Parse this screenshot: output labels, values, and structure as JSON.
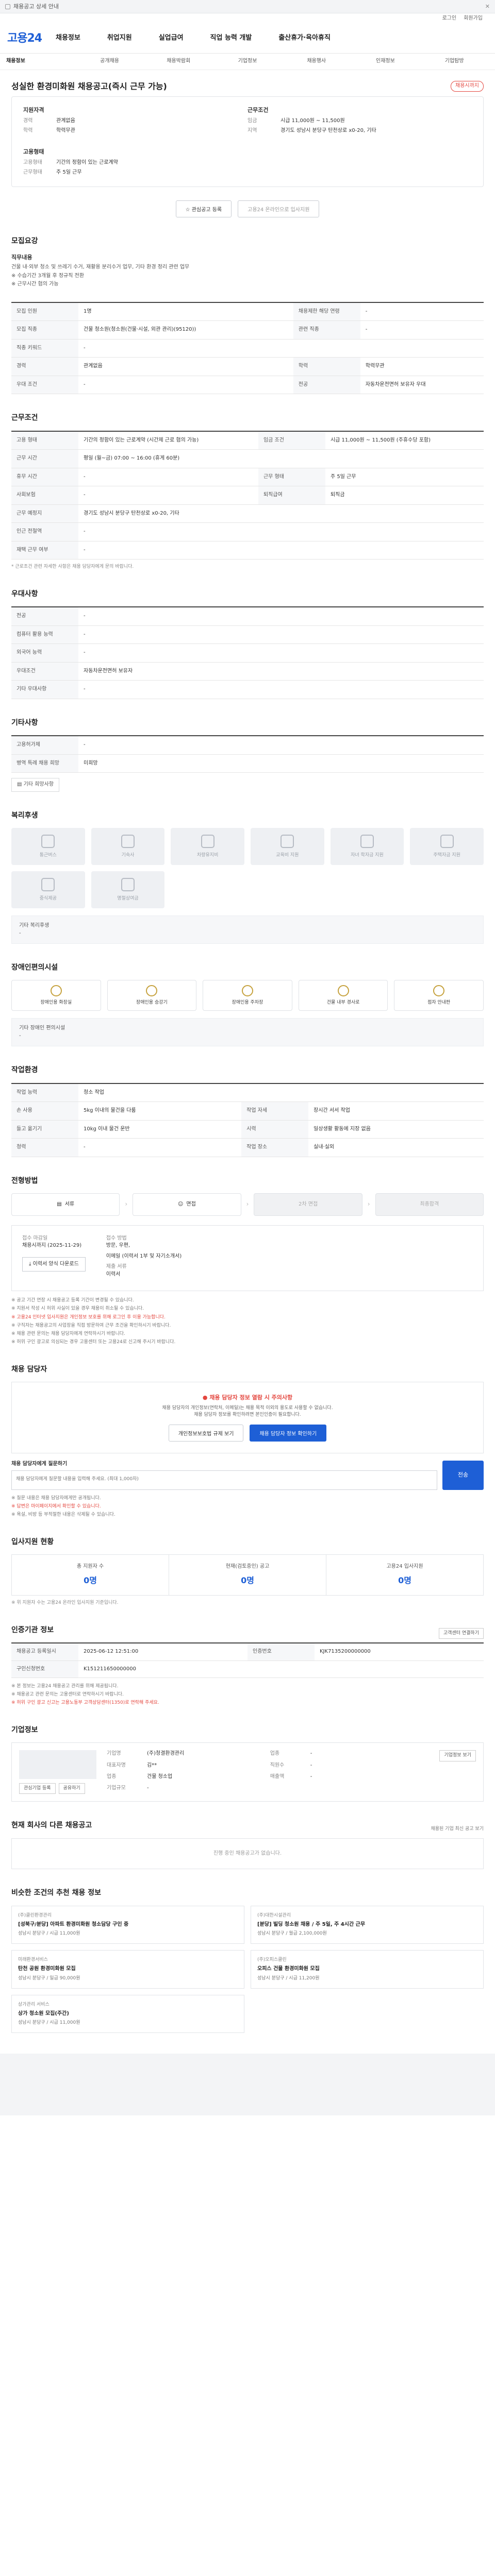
{
  "topbar": {
    "text": "채용공고 상세 안내 "
  },
  "util": [
    "로그인",
    "회원가입"
  ],
  "header": {
    "logo": "고용24",
    "gnb": [
      "채용정보",
      "취업지원",
      "실업급여",
      "직업 능력 개발",
      "출산휴가·육아휴직"
    ]
  },
  "subnav": [
    "채용정보",
    "공개채용",
    "채용박람회",
    "기업정보",
    "채용행사",
    "인재정보",
    "기업탐방"
  ],
  "title": {
    "text": "성실한 환경미화원 채용공고(즉시 근무 가능)",
    "tag": "채용시까지"
  },
  "summary": {
    "left_head": "지원자격",
    "left": [
      [
        "경력",
        "관계없음"
      ],
      [
        "학력",
        "학력무관"
      ]
    ],
    "right_head": "근무조건",
    "right": [
      [
        "임금",
        "시급 11,000원 ~ 11,500원"
      ],
      [
        "지역",
        "경기도 성남시 분당구 탄천상로 x0-20, 기타"
      ]
    ],
    "left2_head": "고용형태",
    "left2": [
      [
        "고용형태",
        "기간의 정함이 있는 근로계약"
      ],
      [
        "근무형태",
        "주 5일 근무"
      ]
    ]
  },
  "buttons": {
    "interest": "관심공고 등록",
    "apply": "고용24 온라인으로 입사지원"
  },
  "recruit": {
    "h": "모집요강",
    "lab": "직무내용",
    "lines": [
      "건물 내·외부 청소 및 쓰레기 수거, 재활용 분리수거 업무, 기타 환경 정리 관련 업무",
      "※ 수습기간 3개월 후 정규직 전환",
      "※ 근무시간 협의 가능"
    ],
    "rows": [
      [
        "모집 인원",
        "1명",
        "채용제한 해당 연령",
        "-"
      ],
      [
        "모집 직종",
        "건물 청소원(청소원(건물·시설, 외관 관리)(95120))",
        "관련 직종",
        "-"
      ],
      [
        "직종 키워드",
        "-",
        "",
        ""
      ],
      [
        "경력",
        "관계없음",
        "학력",
        "학력무관"
      ],
      [
        "우대 조건",
        "-",
        "전공",
        "자동차운전면허 보유자 우대"
      ]
    ]
  },
  "cond": {
    "h": "근무조건",
    "rows": [
      [
        "고용 형태",
        "기간의 정함이 있는 근로계약 (시간제 근로 협의 가능)",
        "임금 조건",
        "시급 11,000원 ~ 11,500원 (주휴수당 포함)"
      ],
      [
        "근무 시간",
        "평일 (월~금) 07:00 ~ 16:00 (휴게 60분)",
        "",
        ""
      ],
      [
        "휴무 시간",
        "-",
        "근무 형태",
        "주 5일 근무"
      ],
      [
        "사회보험",
        "-",
        "퇴직급여",
        "퇴직금"
      ],
      [
        "근무 예정지",
        "경기도 성남시 분당구 탄천상로 x0-20, 기타",
        "",
        ""
      ],
      [
        "인근 전철역",
        "-",
        "",
        ""
      ],
      [
        "재택 근무 여부",
        "-",
        "",
        ""
      ]
    ],
    "note": "* 근로조건 관련 자세한 사항은 채용 담당자에게 문의 바랍니다."
  },
  "prefer": {
    "h": "우대사항",
    "rows": [
      [
        "전공",
        "-"
      ],
      [
        "컴퓨터 활용 능력",
        "-"
      ],
      [
        "외국어 능력",
        "-"
      ],
      [
        "우대조건",
        "자동차운전면허 보유자"
      ],
      [
        "기타 우대사항",
        "-"
      ]
    ]
  },
  "etc": {
    "h": "기타사항",
    "rows": [
      [
        "고용허가제",
        "-"
      ],
      [
        "병역 특례 채용 희망",
        "미희망"
      ]
    ],
    "link": "기타 희망사항"
  },
  "welfare": {
    "h": "복리후생",
    "items": [
      "통근버스",
      "기숙사",
      "차량유지비",
      "교육비 지원",
      "자녀 학자금 지원",
      "주택자금 지원",
      "중식제공",
      "명절상여금"
    ],
    "box_label": "기타 복리후생",
    "box_value": "-"
  },
  "disab": {
    "h": "장애인편의시설",
    "items": [
      "장애인용 화장실",
      "장애인용 승강기",
      "장애인용 주차장",
      "건물 내부 경사로",
      "점자 안내판"
    ],
    "box_label": "기타 장애인 편의시설",
    "box_value": "-"
  },
  "work_env": {
    "h": "작업환경",
    "rows": [
      [
        "작업 능력",
        "청소 작업",
        "",
        ""
      ],
      [
        "손 사용",
        "5kg 이내의 물건을 다룸",
        "작업 자세",
        "장시간 서서 작업"
      ],
      [
        "들고 옮기기",
        "10kg 이내 물건 운반",
        "시력",
        "일상생활 활동에 지장 없음"
      ],
      [
        "청력",
        "-",
        "작업 장소",
        "실내·실외"
      ]
    ]
  },
  "select": {
    "h": "전형방법",
    "steps": [
      "서류",
      "면접",
      "2차 면접",
      "최종합격"
    ]
  },
  "apply": {
    "t1": "접수 마감일",
    "v1": "채용시까지 (2025-11-29)",
    "t2": "접수 방법",
    "v2": "방문, 우편,",
    "v2b": "이메일 (이력서 1부 및 자기소개서)",
    "t3": "제출 서류",
    "v3": "이력서",
    "btn": "이력서 양식 다운로드",
    "warns": [
      "※ 공고 기간 연장 시 채용공고 등록 기간이 변경될 수 있습니다.",
      "※ 지원서 작성 시 허위 사실이 있을 경우 채용이 취소될 수 있습니다.",
      "※ 고용24 인터넷 입사지원은 개인정보 보호를 위해 로그인 후 이용 가능합니다.",
      "※ 구직자는 채용공고의 사업장을 직접 방문하여 근무 조건을 확인하시기 바랍니다.",
      "※ 채용 관련 문의는 채용 담당자에게 연락하시기 바랍니다.",
      "※ 허위 구인 광고로 의심되는 경우 고용센터 또는 고용24로 신고해 주시기 바랍니다."
    ]
  },
  "manager": {
    "h": "채용 담당자",
    "alert": "채용 담당자 정보 열람 시 주의사항",
    "p1": "채용 담당자의 개인정보(연락처, 이메일)는 채용 목적 이외의 용도로 사용할 수 없습니다.",
    "p2": "채용 담당자 정보를 확인하려면 본인인증이 필요합니다.",
    "b1": "개인정보보호법 규제 보기",
    "b2": "채용 담당자 정보 확인하기",
    "qa_label": "채용 담당자에게 질문하기",
    "qa_placeholder": "채용 담당자에게 질문할 내용을 입력해 주세요. (최대 1,000자)",
    "qa_btn": "전송",
    "notes": [
      "※ 질문 내용은 채용 담당자에게만 공개됩니다.",
      "※ 답변은 마이페이지에서 확인할 수 있습니다.",
      "※ 욕설, 비방 등 부적절한 내용은 삭제될 수 있습니다."
    ]
  },
  "status": {
    "h": "입사지원 현황",
    "c1": "총 지원자 수",
    "n1": "0명",
    "c2": "현재(검토중인) 공고",
    "n2": "0명",
    "c3": "고용24 입사지원",
    "n3": "0명",
    "note": "※ 위 지원자 수는 고용24 온라인 입사지원 기준입니다."
  },
  "mgmt": {
    "h": "인증기관 정보",
    "btn": "고객센터 연결하기",
    "rows": [
      [
        "채용공고 등록일시",
        "2025-06-12 12:51:00",
        "인증번호",
        "KJK7135200000000"
      ],
      [
        "구인신청번호",
        "K151211650000000",
        "",
        ""
      ]
    ],
    "notes": [
      "※ 본 정보는 고용24 채용공고 관리를 위해 제공됩니다.",
      "※ 채용공고 관련 문의는 고용센터로 연락하시기 바랍니다.",
      "※ 허위 구인 광고 신고는 고용노동부 고객상담센터(1350)로 연락해 주세요."
    ]
  },
  "company": {
    "h": "기업정보",
    "btn": "기업정보 보기",
    "info": [
      [
        "기업명",
        "(주)청결환경관리",
        "업종",
        "-"
      ],
      [
        "대표자명",
        "김**",
        "직원수",
        "-"
      ],
      [
        "업종",
        "건물 청소업",
        "매출액",
        "-"
      ],
      [
        "기업규모",
        "-",
        "",
        ""
      ]
    ],
    "s1": "관심기업 등록",
    "s2": "공유하기"
  },
  "other": {
    "h": "현재 회사의 다른 채용공고",
    "more": "채용된 기업 최신 공고 보기",
    "empty": "진행 중인 채용공고가 없습니다."
  },
  "recs": {
    "h": "비슷한 조건의 추천 채용 정보",
    "items": [
      {
        "co": "(주)클린환경관리",
        "tt": "[성북구/분당] 아파트 환경미화원 청소담당 구인 중",
        "meta": "성남시 분당구 / 시급 11,000원"
      },
      {
        "co": "(주)대한시설관리",
        "tt": "[분당] 빌딩 청소원 채용 / 주 5일, 주 4시간 근무",
        "meta": "성남시 분당구 / 월급 2,100,000원"
      },
      {
        "co": "미래환경서비스",
        "tt": "탄천 공원 환경미화원 모집",
        "meta": "성남시 분당구 / 일급 90,000원"
      },
      {
        "co": "(주)오피스클린",
        "tt": "오피스 건물 환경미화원 모집",
        "meta": "성남시 분당구 / 시급 11,200원"
      },
      {
        "co": "상가관리 서비스",
        "tt": "상가 청소원 모집(주간)",
        "meta": "성남시 분당구 / 시급 11,000원"
      }
    ]
  }
}
